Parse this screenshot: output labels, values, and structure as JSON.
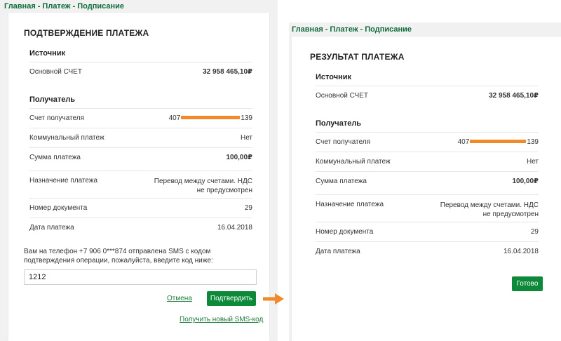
{
  "breadcrumb": [
    "Главная",
    "Платеж",
    "Подписание"
  ],
  "breadcrumb_separator": "-",
  "confirmation": {
    "title": "ПОДТВЕРЖДЕНИЕ ПЛАТЕЖА",
    "source_header": "Источник",
    "account_label": "Основной СЧЕТ",
    "account_value": "32 958 465,10₽",
    "recipient_header": "Получатель",
    "recipient_account_label": "Счет получателя",
    "recipient_account_prefix": "407",
    "recipient_account_suffix": "139",
    "utility_label": "Коммунальный платеж",
    "utility_value": "Нет",
    "amount_label": "Сумма платежа",
    "amount_value": "100,00₽",
    "purpose_label": "Назначение платежа",
    "purpose_value": "Перевод между счетами. НДС не предусмотрен",
    "doc_number_label": "Номер документа",
    "doc_number_value": "29",
    "date_label": "Дата платежа",
    "date_value": "16.04.2018",
    "sms_info": "Вам на телефон +7 906 0***874 отправлена SMS с кодом подтверждения операции, пожалуйста, введите код ниже:",
    "code_value": "1212",
    "cancel_label": "Отмена",
    "confirm_label": "Подтвердить",
    "new_sms_label": "Получить новый SMS-код"
  },
  "result": {
    "title": "РЕЗУЛЬТАТ ПЛАТЕЖА",
    "source_header": "Источник",
    "account_label": "Основной СЧЕТ",
    "account_value": "32 958 465,10₽",
    "recipient_header": "Получатель",
    "recipient_account_label": "Счет получателя",
    "recipient_account_prefix": "407",
    "recipient_account_suffix": "139",
    "utility_label": "Коммунальный платеж",
    "utility_value": "Нет",
    "amount_label": "Сумма платежа",
    "amount_value": "100,00₽",
    "purpose_label": "Назначение платежа",
    "purpose_value": "Перевод между счетами. НДС не предусмотрен",
    "doc_number_label": "Номер документа",
    "doc_number_value": "29",
    "date_label": "Дата платежа",
    "date_value": "16.04.2018",
    "done_label": "Готово"
  },
  "colors": {
    "accent_green": "#0c8a3a",
    "breadcrumb_green": "#0f6b3c",
    "mask_orange": "#f08a2a"
  },
  "icons": {
    "transition": "arrow-right-icon"
  }
}
